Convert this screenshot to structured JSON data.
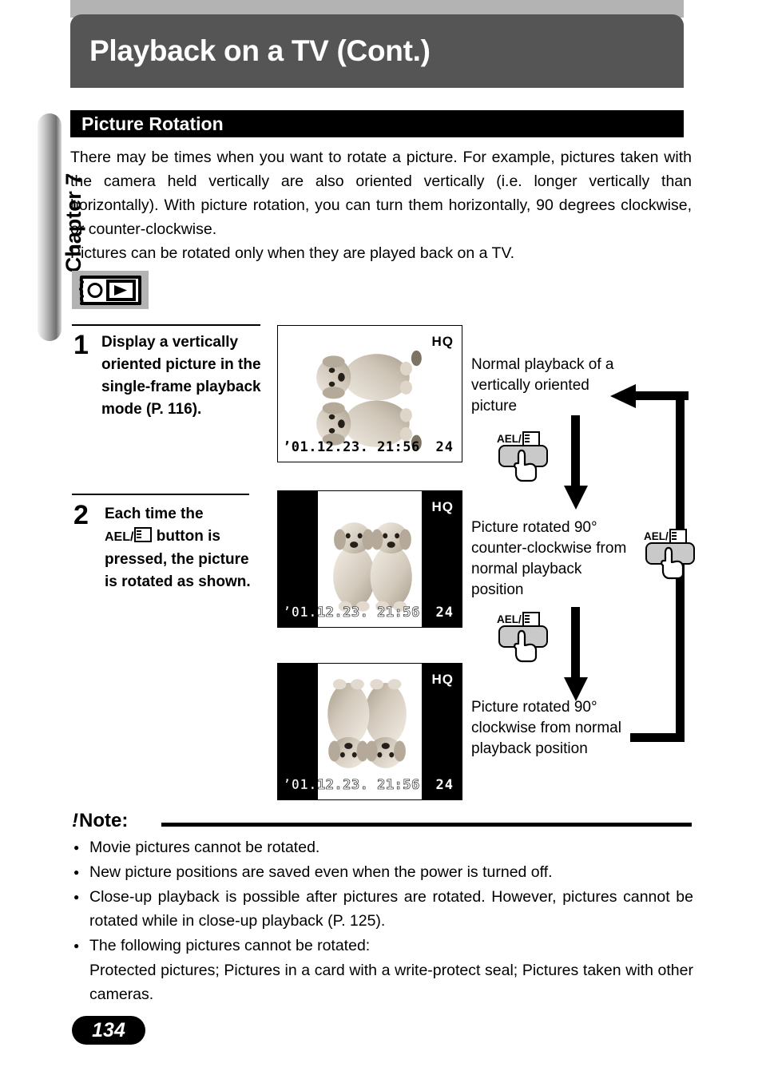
{
  "header": {
    "title": "Playback on a TV (Cont.)"
  },
  "sidebar": {
    "chapter_label": "Chapter 7"
  },
  "section": {
    "title": "Picture Rotation"
  },
  "intro": {
    "line1": "There may be times when you want to rotate a picture.  For example, pictures taken with the camera held vertically are also oriented vertically (i.e. longer vertically than horizontally). With picture rotation, you can turn them horizontally, 90 degrees clockwise, or counter-clockwise.",
    "line2": "Pictures can be rotated only when they are played back on a TV."
  },
  "mode_icon": {
    "name": "playback-mode-dial-icon"
  },
  "steps": [
    {
      "number": "1",
      "text": "Display a vertically oriented picture in the single-frame playback mode (P. 116)."
    },
    {
      "number": "2",
      "text_before": "Each time the",
      "button_label": "AEL/",
      "text_after": "button is pressed, the picture is rotated as shown."
    }
  ],
  "lcd_screens": [
    {
      "quality": "HQ",
      "date": "’01.12.23. 21:56",
      "count": "24",
      "orientation": "rotated-90-ccw"
    },
    {
      "quality": "HQ",
      "date": "’01.12.23. 21:56",
      "count": "24",
      "orientation": "normal-portrait"
    },
    {
      "quality": "HQ",
      "date": "’01.12.23. 21:56",
      "count": "24",
      "orientation": "rotated-180"
    }
  ],
  "annotations": [
    {
      "text": "Normal playback of a vertically oriented picture"
    },
    {
      "text": "Picture rotated 90° counter-clockwise from normal playback position"
    },
    {
      "text": "Picture rotated 90° clockwise from normal playback position"
    }
  ],
  "buttons": {
    "ael_label": "AEL/"
  },
  "note": {
    "bang": "!",
    "heading": "Note:",
    "items": [
      "Movie pictures cannot be rotated.",
      "New picture positions are saved even when the power is turned off.",
      "Close-up playback is possible after pictures are rotated. However, pictures cannot be rotated while in close-up playback (P. 125).",
      "The following pictures cannot be rotated:"
    ],
    "sub_item": "Protected pictures; Pictures in a card with a write-protect seal; Pictures taken with other cameras."
  },
  "page_number": "134"
}
